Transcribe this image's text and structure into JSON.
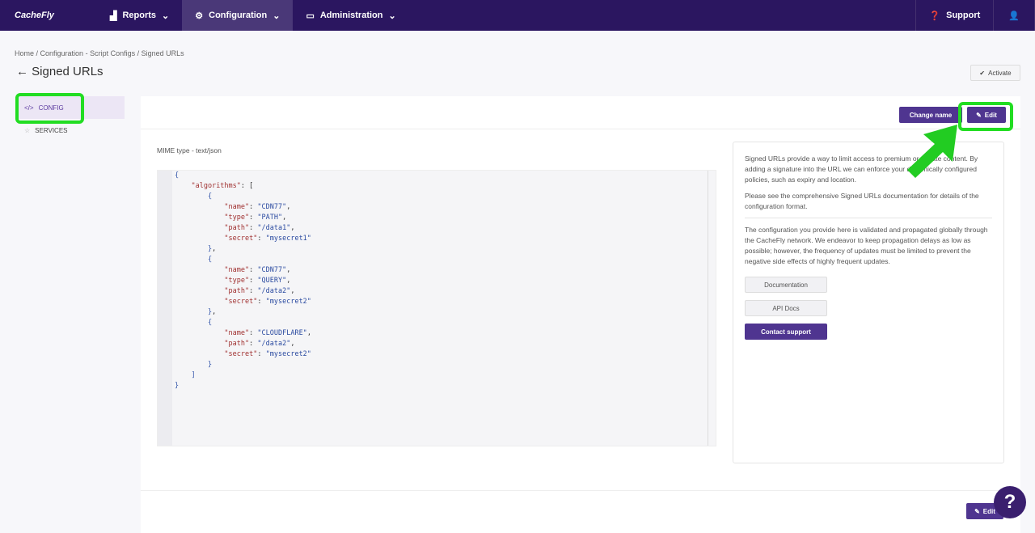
{
  "topbar": {
    "logo": "CacheFly",
    "nav": [
      {
        "label": "Reports",
        "icon": "bar-chart-icon"
      },
      {
        "label": "Configuration",
        "icon": "gear-icon"
      },
      {
        "label": "Administration",
        "icon": "monitor-icon"
      }
    ],
    "support": "Support"
  },
  "breadcrumb": [
    "Home",
    "Configuration - Script Configs",
    "Signed URLs"
  ],
  "page_title": "Signed URLs",
  "activate": "Activate",
  "sidebar": [
    {
      "label": "CONFIG",
      "icon": "code-icon"
    },
    {
      "label": "SERVICES",
      "icon": "star-icon"
    }
  ],
  "header": {
    "change_name": "Change name",
    "edit": "Edit"
  },
  "mime": "MIME type - text/json",
  "code": "{\n    \"algorithms\": [\n        {\n            \"name\": \"CDN77\",\n            \"type\": \"PATH\",\n            \"path\": \"/data1\",\n            \"secret\": \"mysecret1\"\n        },\n        {\n            \"name\": \"CDN77\",\n            \"type\": \"QUERY\",\n            \"path\": \"/data2\",\n            \"secret\": \"mysecret2\"\n        },\n        {\n            \"name\": \"CLOUDFLARE\",\n            \"path\": \"/data2\",\n            \"secret\": \"mysecret2\"\n        }\n    ]\n}",
  "info": {
    "p1": "Signed URLs provide a way to limit access to premium or private content. By adding a signature into the URL we can enforce your dynamically configured policies, such as expiry and location.",
    "p2": "Please see the comprehensive Signed URLs documentation for details of the configuration format.",
    "p3": "The configuration you provide here is validated and propagated globally through the CacheFly network. We endeavor to keep propagation delays as low as possible; however, the frequency of updates must be limited to prevent the negative side effects of highly frequent updates.",
    "buttons": [
      "Documentation",
      "API Docs",
      "Contact support"
    ]
  },
  "footer_edit": "Edit",
  "help": "?"
}
